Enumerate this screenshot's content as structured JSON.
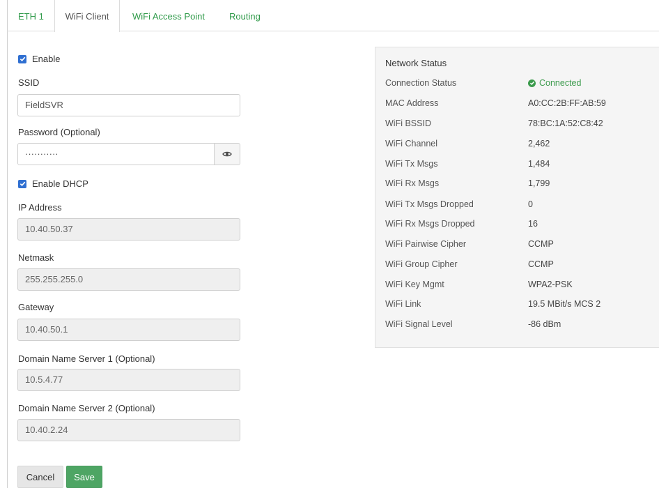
{
  "tabs": [
    {
      "label": "ETH 1"
    },
    {
      "label": "WiFi Client",
      "active": true
    },
    {
      "label": "WiFi Access Point"
    },
    {
      "label": "Routing"
    }
  ],
  "form": {
    "enable_label": "Enable",
    "enable_checked": true,
    "ssid_label": "SSID",
    "ssid_value": "FieldSVR",
    "password_label": "Password (Optional)",
    "password_value": "···········",
    "dhcp_label": "Enable DHCP",
    "dhcp_checked": true,
    "ip_label": "IP Address",
    "ip_value": "10.40.50.37",
    "netmask_label": "Netmask",
    "netmask_value": "255.255.255.0",
    "gateway_label": "Gateway",
    "gateway_value": "10.40.50.1",
    "dns1_label": "Domain Name Server 1 (Optional)",
    "dns1_value": "10.5.4.77",
    "dns2_label": "Domain Name Server 2 (Optional)",
    "dns2_value": "10.40.2.24"
  },
  "actions": {
    "cancel_label": "Cancel",
    "save_label": "Save"
  },
  "network_status": {
    "title": "Network Status",
    "rows": [
      {
        "label": "Connection Status",
        "value": "Connected"
      },
      {
        "label": "MAC Address",
        "value": "A0:CC:2B:FF:AB:59"
      },
      {
        "label": "WiFi BSSID",
        "value": "78:BC:1A:52:C8:42"
      },
      {
        "label": "WiFi Channel",
        "value": "2,462"
      },
      {
        "label": "WiFi Tx Msgs",
        "value": "1,484"
      },
      {
        "label": "WiFi Rx Msgs",
        "value": "1,799"
      },
      {
        "label": "WiFi Tx Msgs Dropped",
        "value": "0"
      },
      {
        "label": "WiFi Rx Msgs Dropped",
        "value": "16"
      },
      {
        "label": "WiFi Pairwise Cipher",
        "value": "CCMP"
      },
      {
        "label": "WiFi Group Cipher",
        "value": "CCMP"
      },
      {
        "label": "WiFi Key Mgmt",
        "value": "WPA2-PSK"
      },
      {
        "label": "WiFi Link",
        "value": "19.5 MBit/s MCS 2"
      },
      {
        "label": "WiFi Signal Level",
        "value": "-86 dBm"
      }
    ]
  },
  "colors": {
    "accent_green": "#2f9a49",
    "save_green": "#4ea564",
    "checkbox_blue": "#2f6fd1",
    "connected_green": "#3c9b4d"
  },
  "icons": {
    "checkbox": "check-icon",
    "password_toggle": "eye-icon",
    "connected": "check-circle-icon"
  }
}
